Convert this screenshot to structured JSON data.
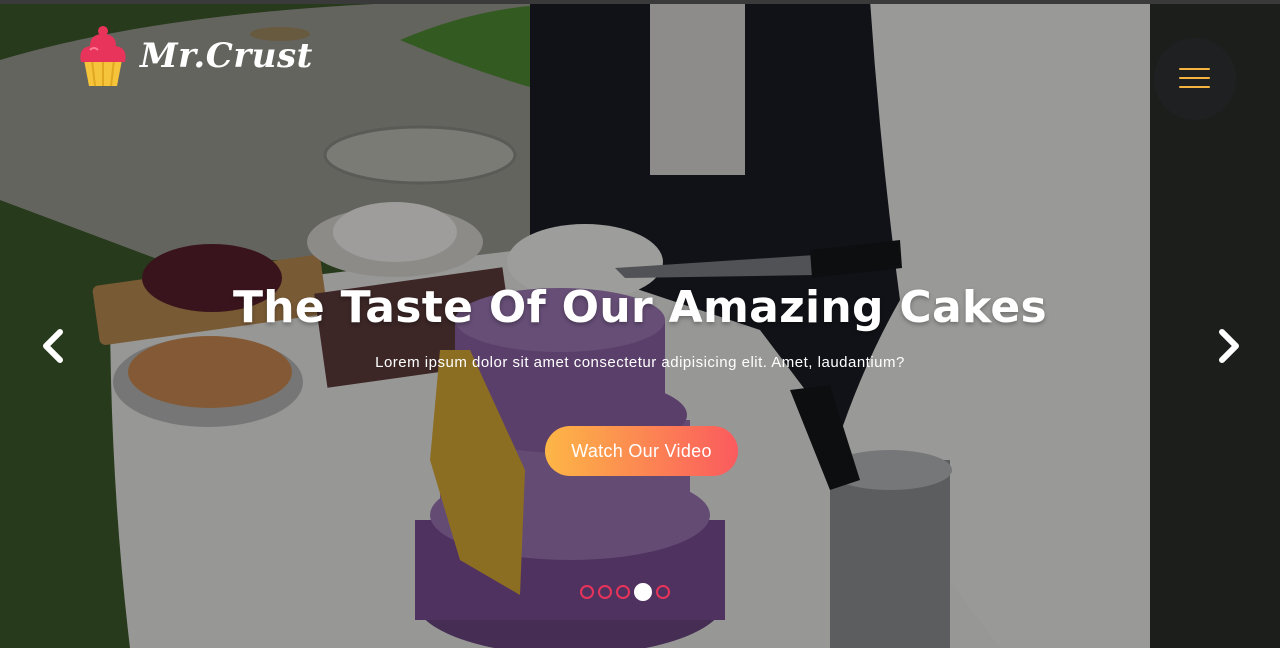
{
  "brand": {
    "name": "Mr.Crust",
    "logo_icon": "cupcake-icon"
  },
  "header": {
    "menu_icon": "hamburger-menu-icon",
    "menu_color": "#f5b440"
  },
  "slider": {
    "title": "The Taste Of Our Amazing Cakes",
    "subtitle": "Lorem ipsum dolor sit amet consectetur adipisicing elit. Amet, laudantium?",
    "cta_label": "Watch Our Video",
    "cta_gradient": [
      "#fdb646",
      "#fb5a5e"
    ],
    "prev_icon": "chevron-left-icon",
    "next_icon": "chevron-right-icon",
    "slide_count": 5,
    "active_slide": 4
  },
  "colors": {
    "dot_border": "#e8345a",
    "dot_active": "#ffffff"
  }
}
